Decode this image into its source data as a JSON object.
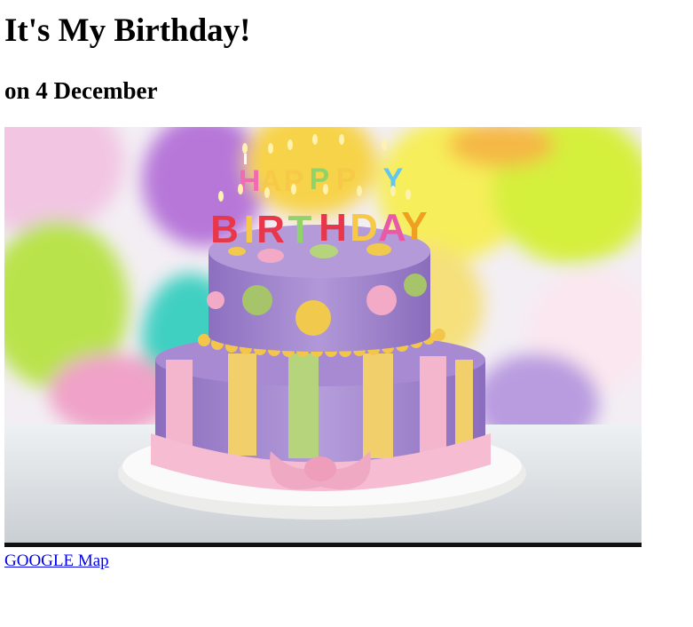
{
  "page": {
    "heading": "It's My Birthday!",
    "subheading": "on 4 December"
  },
  "image": {
    "subject": "birthday-cake",
    "candle_letters": [
      "H",
      "A",
      "P",
      "P",
      "Y",
      "B",
      "I",
      "R",
      "T",
      "H",
      "D",
      "A",
      "Y"
    ],
    "candle_colors": [
      "#f06bb0",
      "#f7c948",
      "#f7c948",
      "#8fd46a",
      "#62c6ef",
      "#e8374a",
      "#f7c948",
      "#e8374a",
      "#8fd46a",
      "#e8374a",
      "#f7c948",
      "#e85aa8",
      "#f0a020"
    ]
  },
  "links": {
    "map_label": "GOOGLE Map"
  },
  "colors": {
    "link": "#0000ee",
    "cake_purple": "#a98ad0",
    "ribbon_pink": "#f4b6cc",
    "stripe_yellow": "#f1cf6a",
    "stripe_green": "#b6d47c"
  }
}
